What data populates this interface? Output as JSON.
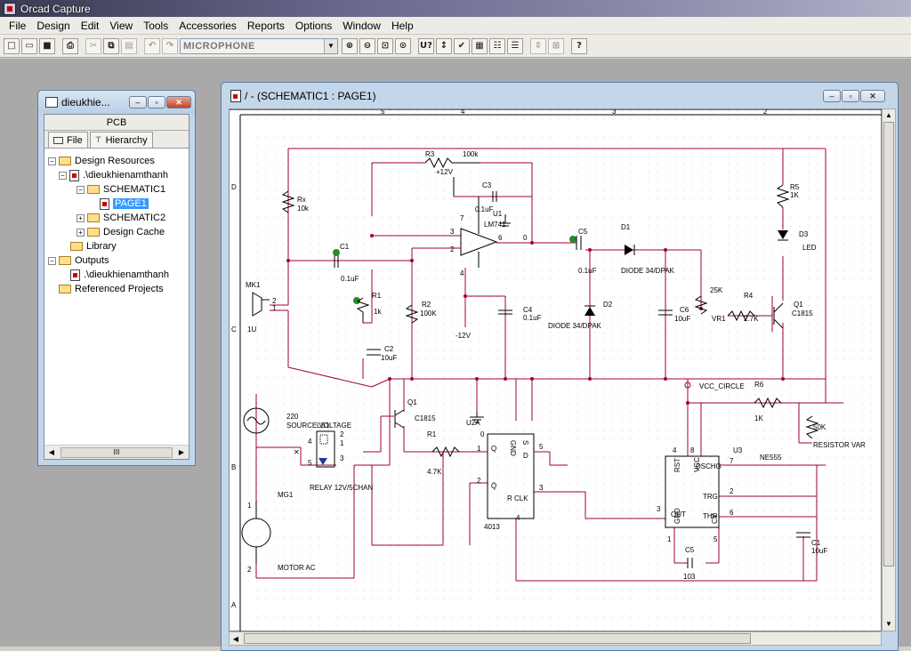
{
  "app": {
    "title": "Orcad Capture"
  },
  "menu": [
    "File",
    "Design",
    "Edit",
    "View",
    "Tools",
    "Accessories",
    "Reports",
    "Options",
    "Window",
    "Help"
  ],
  "toolbar": {
    "part_combo_value": "MICROPHONE"
  },
  "project": {
    "title": "dieukhie...",
    "header": "PCB",
    "tabs": [
      "File",
      "Hierarchy"
    ],
    "tree": [
      {
        "label": "Design Resources"
      },
      {
        "label": ".\\dieukhienamthanh"
      },
      {
        "label": "SCHEMATIC1"
      },
      {
        "label": "PAGE1"
      },
      {
        "label": "SCHEMATIC2"
      },
      {
        "label": "Design Cache"
      },
      {
        "label": "Library"
      },
      {
        "label": "Outputs"
      },
      {
        "label": ".\\dieukhienamthanh"
      },
      {
        "label": "Referenced Projects"
      }
    ],
    "hscroll_thumb": "III"
  },
  "schematic": {
    "title": "/ - (SCHEMATIC1 : PAGE1)",
    "border_cols": [
      "5",
      "4",
      "3",
      "2"
    ],
    "border_rows": [
      "D",
      "C",
      "B",
      "A"
    ],
    "labels": {
      "r3": "R3",
      "r3_val": "100k",
      "plus12": "+12V",
      "c3": "C3",
      "c3_val": "0.1uF",
      "u1": "U1",
      "lm": "LM741",
      "rx": "Rx",
      "rx_val": "10k",
      "c1": "C1",
      "c1_val": "0.1uF",
      "r1": "R1",
      "r1_val": "1k",
      "r2": "R2",
      "r2_val": "100K",
      "c4": "C4",
      "c4_val": "0.1uF",
      "minus12": "-12V",
      "c5": "C5",
      "c5_val": "0.1uF",
      "d1": "D1",
      "d1_val": "DIODE 34/DPAK",
      "d2": "D2",
      "d2_val": "DIODE 34/DPAK",
      "c6": "C6",
      "c6_val": "10uF",
      "vr1": "VR1",
      "vr1_val": "25K",
      "r4": "R4",
      "r4_val": "2.7K",
      "r5": "R5",
      "r5_val": "1K",
      "d3": "D3",
      "d3_val": "LED",
      "q1": "Q1",
      "q1_val": "C1815",
      "mk1": "MK1",
      "mk1_val": "1U",
      "c2": "C2",
      "c2_val": "10uF",
      "vcc": "VCC_CIRCLE",
      "r6": "R6",
      "r6_val": "1K",
      "pot": "50K",
      "pot_val": "RESISTOR VAR",
      "src": "220",
      "src_val": "SOURCE VOLTAGE",
      "ls1": "LS1",
      "relay": "RELAY 12V/5CHAN",
      "q1b": "Q1",
      "q1b_val": "C1815",
      "r1b": "R1",
      "r1b_val": "4.7K",
      "u2a": "U2A",
      "u2a_val": "4013",
      "u3": "U3",
      "u3_val": "NE555",
      "c5b": "C5",
      "c5b_val": "103",
      "c1b": "C1",
      "c1b_val": "10uF",
      "mg1": "MG1",
      "mg1_val": "MOTOR AC",
      "pin_gnd": "GND",
      "pin_s": "S",
      "pin_q": "Q",
      "pin_d": "D",
      "pin_qb": "Q̄",
      "pin_r": "R",
      "pin_clk": "CLK",
      "pin_rst": "RST",
      "pin_vcc": "VCC",
      "pin_dschg": "DSCHG",
      "pin_trg": "TRG",
      "pin_thr": "THR",
      "pin_out": "OUT",
      "pin_gnd2": "GND",
      "pin_cv": "CV"
    }
  }
}
